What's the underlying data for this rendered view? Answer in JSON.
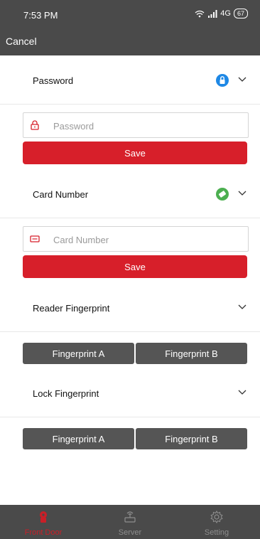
{
  "status_bar": {
    "time": "7:53 PM",
    "network": "4G",
    "battery": "67"
  },
  "nav": {
    "cancel_label": "Cancel"
  },
  "sections": {
    "password": {
      "title": "Password",
      "placeholder": "Password",
      "save_label": "Save"
    },
    "card": {
      "title": "Card Number",
      "placeholder": "Card Number",
      "save_label": "Save"
    },
    "reader": {
      "title": "Reader Fingerprint",
      "btn_a": "Fingerprint A",
      "btn_b": "Fingerprint B"
    },
    "lock": {
      "title": "Lock Fingerprint",
      "btn_a": "Fingerprint A",
      "btn_b": "Fingerprint B"
    }
  },
  "tabs": [
    {
      "label": "Front Door",
      "icon": "lock-door-icon",
      "active": true
    },
    {
      "label": "Server",
      "icon": "router-icon",
      "active": false
    },
    {
      "label": "Setting",
      "icon": "gear-icon",
      "active": false
    }
  ],
  "colors": {
    "accent": "#d71f2a",
    "bar": "#4a4a4a",
    "password_badge": "#1e88e5",
    "card_badge": "#4caf50"
  }
}
